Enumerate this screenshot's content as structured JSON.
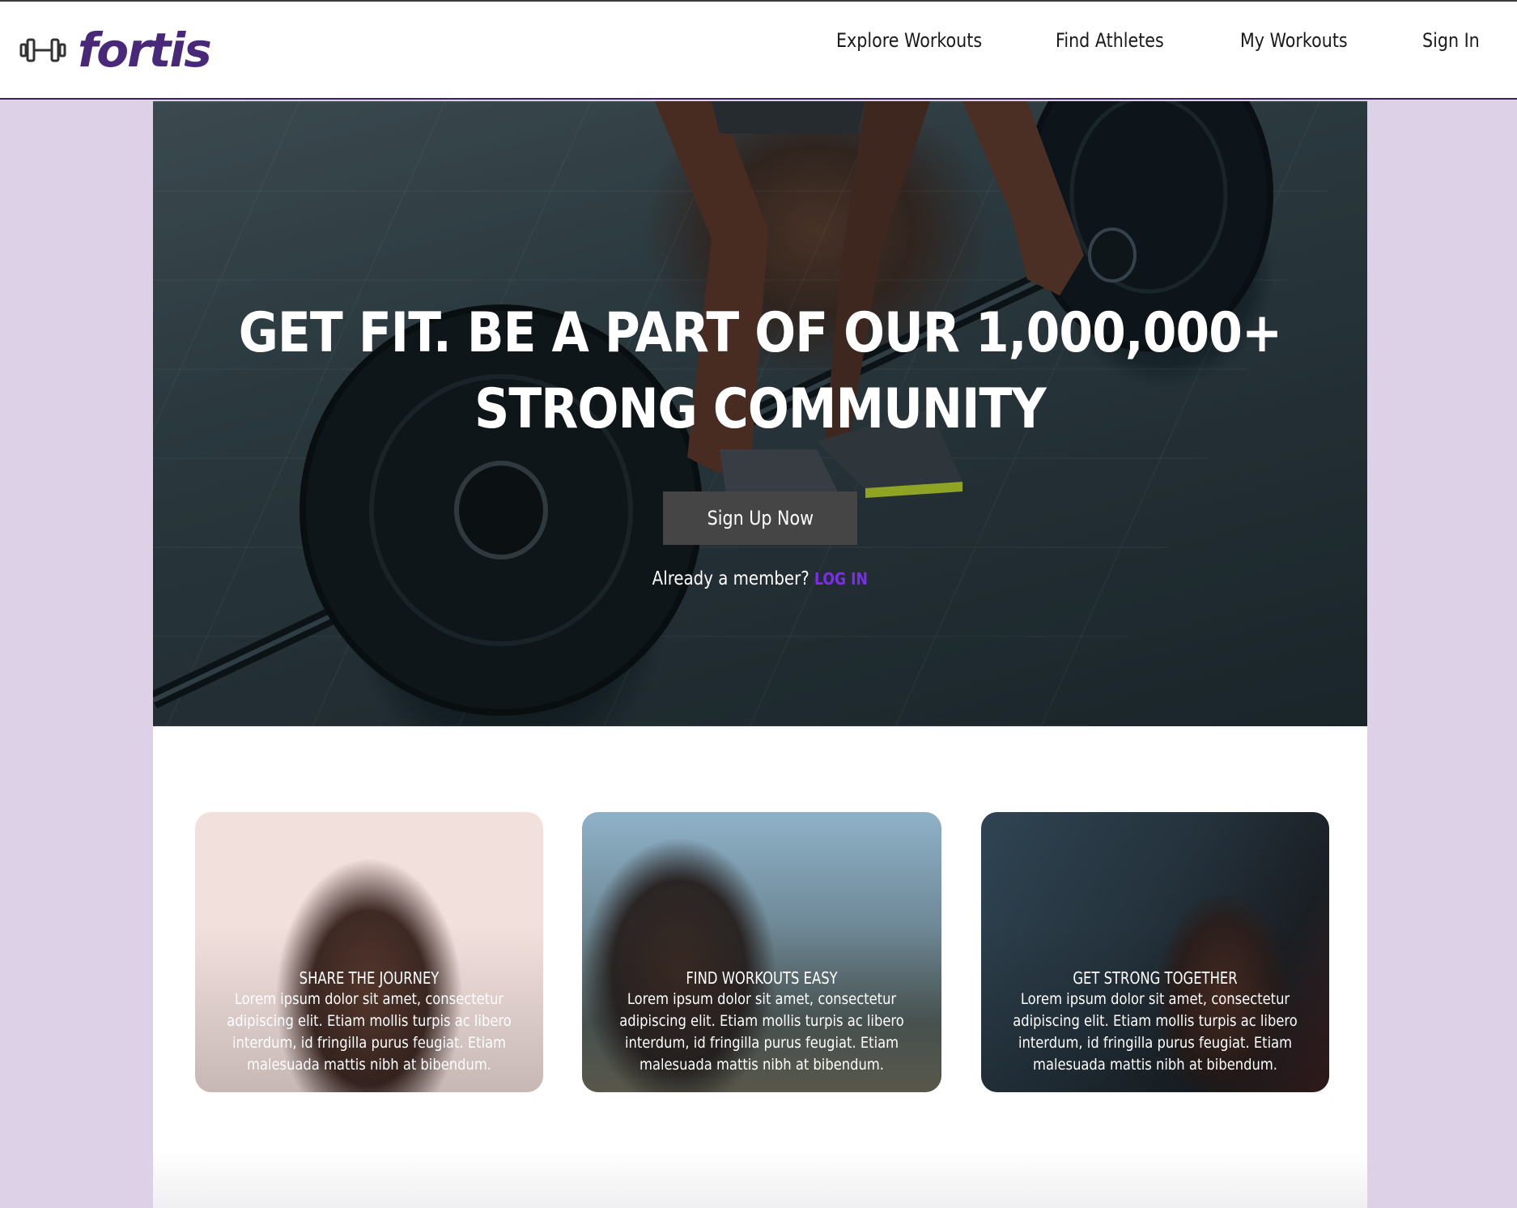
{
  "brand": {
    "name": "fortis",
    "icon": "dumbbell-icon",
    "color": "#472879"
  },
  "nav": {
    "items": [
      {
        "label": "Explore Workouts"
      },
      {
        "label": "Find Athletes"
      },
      {
        "label": "My Workouts"
      },
      {
        "label": "Sign In"
      }
    ]
  },
  "hero": {
    "title": "GET FIT. BE A PART OF OUR 1,000,000+ STRONG COMMUNITY",
    "cta_label": "Sign Up Now",
    "member_prompt": "Already a member?",
    "login_label": "LOG IN"
  },
  "features": [
    {
      "title": "SHARE THE JOURNEY",
      "body": "Lorem ipsum dolor sit amet, consectetur adipiscing elit. Etiam mollis turpis ac libero interdum, id fringilla purus feugiat. Etiam malesuada mattis nibh at bibendum."
    },
    {
      "title": "FIND WORKOUTS EASY",
      "body": "Lorem ipsum dolor sit amet, consectetur adipiscing elit. Etiam mollis turpis ac libero interdum, id fringilla purus feugiat. Etiam malesuada mattis nibh at bibendum."
    },
    {
      "title": "GET STRONG TOGETHER",
      "body": "Lorem ipsum dolor sit amet, consectetur adipiscing elit. Etiam mollis turpis ac libero interdum, id fringilla purus feugiat. Etiam malesuada mattis nibh at bibendum."
    }
  ],
  "colors": {
    "page_background": "#ddd1e8",
    "accent": "#7c2df0",
    "button": "#454545"
  }
}
